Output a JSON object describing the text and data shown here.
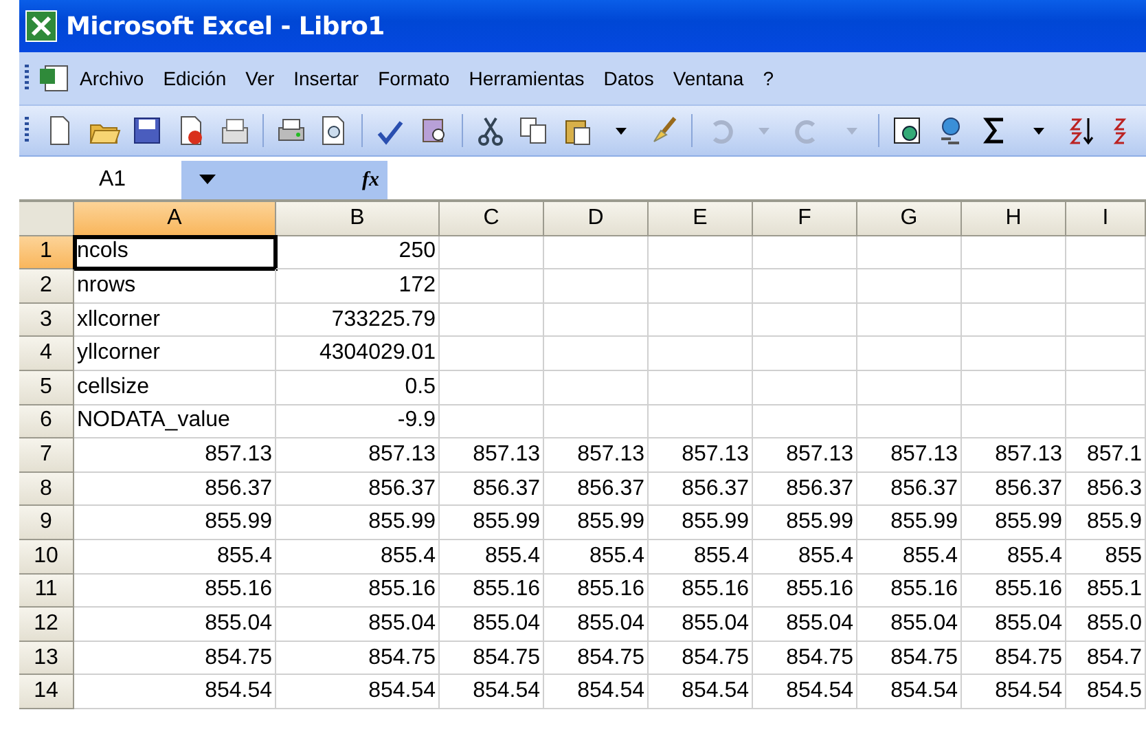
{
  "window": {
    "title": "Microsoft Excel - Libro1"
  },
  "menu": [
    {
      "label": "Archivo"
    },
    {
      "label": "Edición"
    },
    {
      "label": "Ver"
    },
    {
      "label": "Insertar"
    },
    {
      "label": "Formato"
    },
    {
      "label": "Herramientas"
    },
    {
      "label": "Datos"
    },
    {
      "label": "Ventana"
    },
    {
      "label": "?"
    }
  ],
  "formula_bar": {
    "name_box": "A1",
    "function_label": "fx"
  },
  "sheet": {
    "columns": [
      {
        "label": "A",
        "selected": true
      },
      {
        "label": "B",
        "selected": false
      },
      {
        "label": "C",
        "selected": false
      },
      {
        "label": "D",
        "selected": false
      },
      {
        "label": "E",
        "selected": false
      },
      {
        "label": "F",
        "selected": false
      },
      {
        "label": "G",
        "selected": false
      },
      {
        "label": "H",
        "selected": false
      },
      {
        "label": "I",
        "selected": false
      }
    ],
    "rows": [
      {
        "label": "1",
        "selected": true,
        "cells": [
          {
            "value": "ncols",
            "kind": "text",
            "selected": true
          },
          {
            "value": "250",
            "kind": "number",
            "selected": false
          }
        ]
      },
      {
        "label": "2",
        "selected": false,
        "cells": [
          {
            "value": "nrows",
            "kind": "text",
            "selected": false
          },
          {
            "value": "172",
            "kind": "number",
            "selected": false
          }
        ]
      },
      {
        "label": "3",
        "selected": false,
        "cells": [
          {
            "value": "xllcorner",
            "kind": "text",
            "selected": false
          },
          {
            "value": "733225.79",
            "kind": "number",
            "selected": false
          }
        ]
      },
      {
        "label": "4",
        "selected": false,
        "cells": [
          {
            "value": "yllcorner",
            "kind": "text",
            "selected": false
          },
          {
            "value": "4304029.01",
            "kind": "number",
            "selected": false
          }
        ]
      },
      {
        "label": "5",
        "selected": false,
        "cells": [
          {
            "value": "cellsize",
            "kind": "text",
            "selected": false
          },
          {
            "value": "0.5",
            "kind": "number",
            "selected": false
          }
        ]
      },
      {
        "label": "6",
        "selected": false,
        "cells": [
          {
            "value": "NODATA_value",
            "kind": "text",
            "selected": false
          },
          {
            "value": "-9.9",
            "kind": "number",
            "selected": false
          }
        ]
      },
      {
        "label": "7",
        "selected": false,
        "cells": [
          {
            "value": "857.13",
            "kind": "number",
            "selected": false
          },
          {
            "value": "857.13",
            "kind": "number",
            "selected": false
          },
          {
            "value": "857.13",
            "kind": "number",
            "selected": false
          },
          {
            "value": "857.13",
            "kind": "number",
            "selected": false
          },
          {
            "value": "857.13",
            "kind": "number",
            "selected": false
          },
          {
            "value": "857.13",
            "kind": "number",
            "selected": false
          },
          {
            "value": "857.13",
            "kind": "number",
            "selected": false
          },
          {
            "value": "857.13",
            "kind": "number",
            "selected": false
          },
          {
            "value": "857.1",
            "kind": "number",
            "selected": false
          }
        ]
      },
      {
        "label": "8",
        "selected": false,
        "cells": [
          {
            "value": "856.37",
            "kind": "number",
            "selected": false
          },
          {
            "value": "856.37",
            "kind": "number",
            "selected": false
          },
          {
            "value": "856.37",
            "kind": "number",
            "selected": false
          },
          {
            "value": "856.37",
            "kind": "number",
            "selected": false
          },
          {
            "value": "856.37",
            "kind": "number",
            "selected": false
          },
          {
            "value": "856.37",
            "kind": "number",
            "selected": false
          },
          {
            "value": "856.37",
            "kind": "number",
            "selected": false
          },
          {
            "value": "856.37",
            "kind": "number",
            "selected": false
          },
          {
            "value": "856.3",
            "kind": "number",
            "selected": false
          }
        ]
      },
      {
        "label": "9",
        "selected": false,
        "cells": [
          {
            "value": "855.99",
            "kind": "number",
            "selected": false
          },
          {
            "value": "855.99",
            "kind": "number",
            "selected": false
          },
          {
            "value": "855.99",
            "kind": "number",
            "selected": false
          },
          {
            "value": "855.99",
            "kind": "number",
            "selected": false
          },
          {
            "value": "855.99",
            "kind": "number",
            "selected": false
          },
          {
            "value": "855.99",
            "kind": "number",
            "selected": false
          },
          {
            "value": "855.99",
            "kind": "number",
            "selected": false
          },
          {
            "value": "855.99",
            "kind": "number",
            "selected": false
          },
          {
            "value": "855.9",
            "kind": "number",
            "selected": false
          }
        ]
      },
      {
        "label": "10",
        "selected": false,
        "cells": [
          {
            "value": "855.4",
            "kind": "number",
            "selected": false
          },
          {
            "value": "855.4",
            "kind": "number",
            "selected": false
          },
          {
            "value": "855.4",
            "kind": "number",
            "selected": false
          },
          {
            "value": "855.4",
            "kind": "number",
            "selected": false
          },
          {
            "value": "855.4",
            "kind": "number",
            "selected": false
          },
          {
            "value": "855.4",
            "kind": "number",
            "selected": false
          },
          {
            "value": "855.4",
            "kind": "number",
            "selected": false
          },
          {
            "value": "855.4",
            "kind": "number",
            "selected": false
          },
          {
            "value": "855",
            "kind": "number",
            "selected": false
          }
        ]
      },
      {
        "label": "11",
        "selected": false,
        "cells": [
          {
            "value": "855.16",
            "kind": "number",
            "selected": false
          },
          {
            "value": "855.16",
            "kind": "number",
            "selected": false
          },
          {
            "value": "855.16",
            "kind": "number",
            "selected": false
          },
          {
            "value": "855.16",
            "kind": "number",
            "selected": false
          },
          {
            "value": "855.16",
            "kind": "number",
            "selected": false
          },
          {
            "value": "855.16",
            "kind": "number",
            "selected": false
          },
          {
            "value": "855.16",
            "kind": "number",
            "selected": false
          },
          {
            "value": "855.16",
            "kind": "number",
            "selected": false
          },
          {
            "value": "855.1",
            "kind": "number",
            "selected": false
          }
        ]
      },
      {
        "label": "12",
        "selected": false,
        "cells": [
          {
            "value": "855.04",
            "kind": "number",
            "selected": false
          },
          {
            "value": "855.04",
            "kind": "number",
            "selected": false
          },
          {
            "value": "855.04",
            "kind": "number",
            "selected": false
          },
          {
            "value": "855.04",
            "kind": "number",
            "selected": false
          },
          {
            "value": "855.04",
            "kind": "number",
            "selected": false
          },
          {
            "value": "855.04",
            "kind": "number",
            "selected": false
          },
          {
            "value": "855.04",
            "kind": "number",
            "selected": false
          },
          {
            "value": "855.04",
            "kind": "number",
            "selected": false
          },
          {
            "value": "855.0",
            "kind": "number",
            "selected": false
          }
        ]
      },
      {
        "label": "13",
        "selected": false,
        "cells": [
          {
            "value": "854.75",
            "kind": "number",
            "selected": false
          },
          {
            "value": "854.75",
            "kind": "number",
            "selected": false
          },
          {
            "value": "854.75",
            "kind": "number",
            "selected": false
          },
          {
            "value": "854.75",
            "kind": "number",
            "selected": false
          },
          {
            "value": "854.75",
            "kind": "number",
            "selected": false
          },
          {
            "value": "854.75",
            "kind": "number",
            "selected": false
          },
          {
            "value": "854.75",
            "kind": "number",
            "selected": false
          },
          {
            "value": "854.75",
            "kind": "number",
            "selected": false
          },
          {
            "value": "854.7",
            "kind": "number",
            "selected": false
          }
        ]
      },
      {
        "label": "14",
        "selected": false,
        "cells": [
          {
            "value": "854.54",
            "kind": "number",
            "selected": false
          },
          {
            "value": "854.54",
            "kind": "number",
            "selected": false
          },
          {
            "value": "854.54",
            "kind": "number",
            "selected": false
          },
          {
            "value": "854.54",
            "kind": "number",
            "selected": false
          },
          {
            "value": "854.54",
            "kind": "number",
            "selected": false
          },
          {
            "value": "854.54",
            "kind": "number",
            "selected": false
          },
          {
            "value": "854.54",
            "kind": "number",
            "selected": false
          },
          {
            "value": "854.54",
            "kind": "number",
            "selected": false
          },
          {
            "value": "854.5",
            "kind": "number",
            "selected": false
          }
        ]
      }
    ]
  }
}
